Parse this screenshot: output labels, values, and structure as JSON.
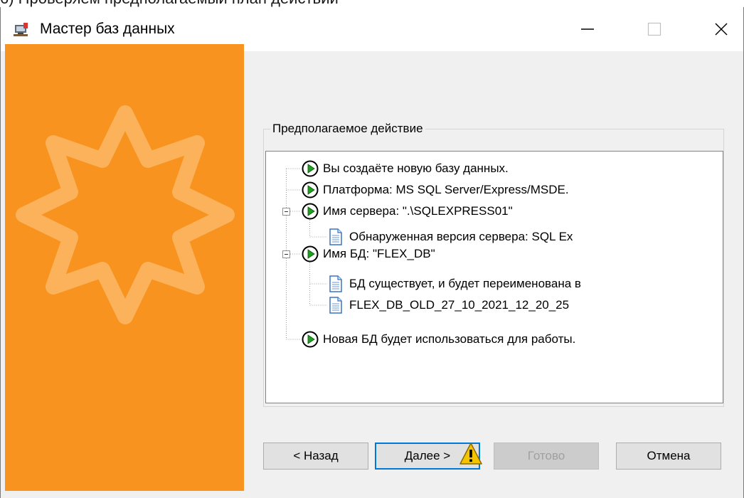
{
  "caption": "6) Проверяем предполагаемый план действий",
  "window": {
    "title": "Мастер баз данных",
    "icon": "database-wizard-icon"
  },
  "titlebar_buttons": [
    "minimize-icon",
    "maximize-icon",
    "close-icon"
  ],
  "sidebar": {
    "color": "#f7931e",
    "decoration": "star-icon"
  },
  "group": {
    "label": "Предполагаемое действие",
    "items": [
      {
        "icon": "play-arrow-icon",
        "text": "Вы создаёте новую базу данных."
      },
      {
        "icon": "play-arrow-icon",
        "text": "Платформа: MS SQL Server/Express/MSDE."
      },
      {
        "icon": "play-arrow-icon",
        "text": "Имя сервера: \".\\SQLEXPRESS01\"",
        "expanded": true
      },
      {
        "icon": "document-icon",
        "text": "Обнаруженная версия сервера: SQL Ex",
        "child": true
      },
      {
        "icon": "play-arrow-icon",
        "text": "Имя БД: \"FLEX_DB\"",
        "expanded": true
      },
      {
        "icon": "document-icon",
        "text": "БД существует, и будет переименована в",
        "child": true
      },
      {
        "icon": "document-icon",
        "text": "FLEX_DB_OLD_27_10_2021_12_20_25",
        "child": true
      },
      {
        "icon": "play-arrow-icon",
        "text": "Новая БД будет использоваться для работы."
      }
    ]
  },
  "buttons": {
    "back": "< Назад",
    "next": "Далее >",
    "finish": "Готово",
    "cancel": "Отмена"
  },
  "overlay": {
    "icon": "warning-icon",
    "color": "#f5c400"
  }
}
